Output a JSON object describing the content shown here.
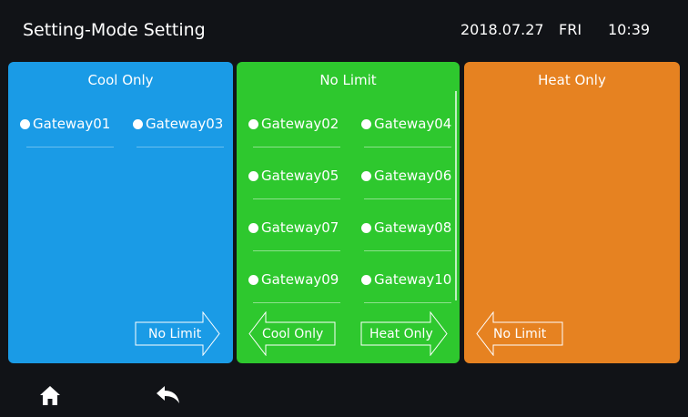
{
  "header": {
    "title": "Setting-Mode Setting",
    "date": "2018.07.27",
    "day": "FRI",
    "time": "10:39"
  },
  "panels": {
    "cool": {
      "title": "Cool Only",
      "color": "#1a9be6",
      "gateways": [
        "Gateway01",
        "Gateway03"
      ],
      "right_button": "No Limit"
    },
    "nolimit": {
      "title": "No Limit",
      "color": "#2ec82e",
      "gateways": [
        "Gateway02",
        "Gateway04",
        "Gateway05",
        "Gateway06",
        "Gateway07",
        "Gateway08",
        "Gateway09",
        "Gateway10"
      ],
      "left_button": "Cool Only",
      "right_button": "Heat Only"
    },
    "heat": {
      "title": "Heat Only",
      "color": "#e68221",
      "left_button": "No Limit"
    }
  },
  "footer": {
    "home_icon": "home-icon",
    "back_icon": "back-arrow-icon"
  }
}
